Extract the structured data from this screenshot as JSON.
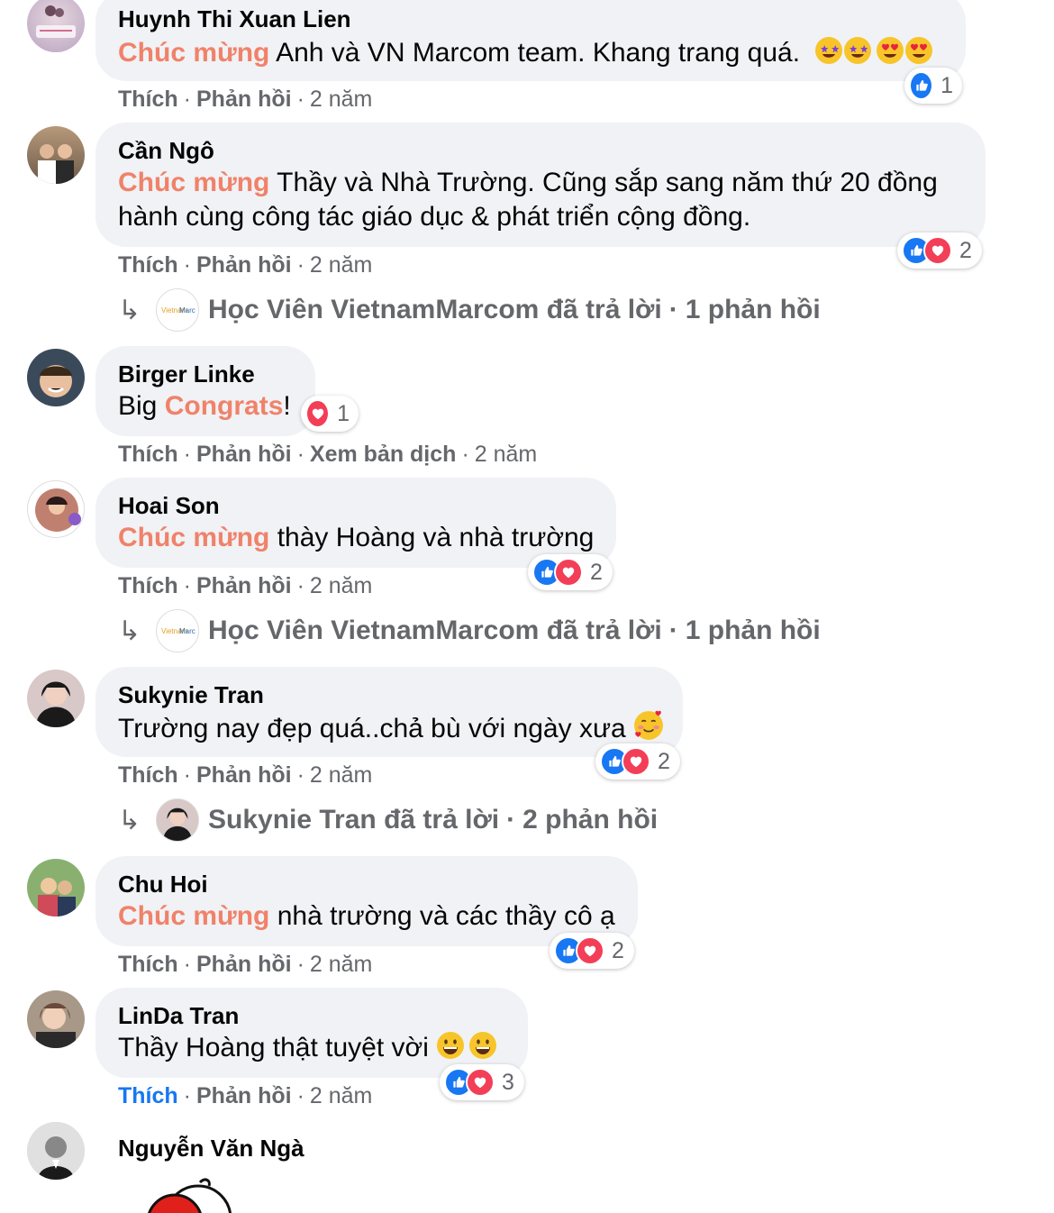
{
  "comments": [
    {
      "author": "Huynh Thi Xuan Lien",
      "highlight": "Chúc mừng",
      "text_line1": " Anh và VN Marcom team. Khang trang quá.",
      "actions": {
        "like": "Thích",
        "reply": "Phản hồi",
        "time": "2 năm"
      },
      "reaction_count": "1"
    },
    {
      "author": "Cần Ngô",
      "highlight": "Chúc mừng",
      "text_line1": " Thầy và Nhà Trường. Cũng sắp sang năm thứ 20 đồng",
      "text_line2": "hành cùng công tác giáo dục & phát triển cộng đồng.",
      "actions": {
        "like": "Thích",
        "reply": "Phản hồi",
        "time": "2 năm"
      },
      "reaction_count": "2",
      "reply_summary": {
        "text": "Học Viên VietnamMarcom đã trả lời",
        "count": "1 phản hồi"
      }
    },
    {
      "author": "Birger Linke",
      "text_pre": "Big ",
      "highlight": "Congrats",
      "text_post": "!",
      "actions": {
        "like": "Thích",
        "reply": "Phản hồi",
        "translate": "Xem bản dịch",
        "time": "2 năm"
      },
      "reaction_count": "1"
    },
    {
      "author": "Hoai Son",
      "highlight": "Chúc mừng",
      "text_line1": " thày Hoàng và nhà trường",
      "actions": {
        "like": "Thích",
        "reply": "Phản hồi",
        "time": "2 năm"
      },
      "reaction_count": "2",
      "reply_summary": {
        "text": "Học Viên VietnamMarcom đã trả lời",
        "count": "1 phản hồi"
      }
    },
    {
      "author": "Sukynie Tran",
      "text_line1": "Trường nay đẹp quá..chả bù với ngày xưa",
      "actions": {
        "like": "Thích",
        "reply": "Phản hồi",
        "time": "2 năm"
      },
      "reaction_count": "2",
      "reply_summary": {
        "text": "Sukynie Tran đã trả lời",
        "count": "2 phản hồi"
      }
    },
    {
      "author": "Chu Hoi",
      "highlight": "Chúc mừng",
      "text_line1": " nhà trường và các thầy cô ạ",
      "actions": {
        "like": "Thích",
        "reply": "Phản hồi",
        "time": "2 năm"
      },
      "reaction_count": "2"
    },
    {
      "author": "LinDa Tran",
      "text_line1": "Thầy Hoàng thật tuyệt vời",
      "actions": {
        "like": "Thích",
        "reply": "Phản hồi",
        "time": "2 năm"
      },
      "reaction_count": "3"
    },
    {
      "author": "Nguyễn Văn Ngà"
    }
  ],
  "colors": {
    "highlight": "#f0826a",
    "like_blue": "#1877f2",
    "love_red": "#f33e58",
    "bubble": "#f0f2f5",
    "meta": "#65676b"
  },
  "icons": [
    "like-icon",
    "love-icon",
    "reply-arrow-icon",
    "star-struck-emoji",
    "heart-eyes-emoji",
    "smiling-hearts-emoji",
    "grinning-emoji"
  ]
}
